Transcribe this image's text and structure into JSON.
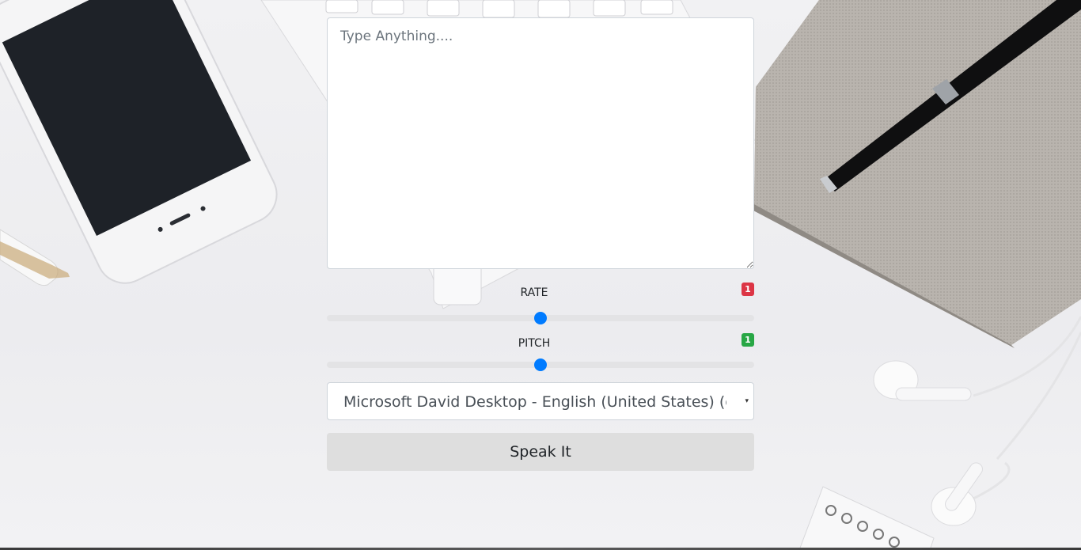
{
  "text_input": {
    "placeholder": "Type Anything....",
    "value": ""
  },
  "rate": {
    "label": "RATE",
    "value": 1,
    "value_text": "1",
    "min": 0.5,
    "max": 1.5,
    "badge_color": "#dc3545"
  },
  "pitch": {
    "label": "PITCH",
    "value": 1,
    "value_text": "1",
    "min": 0,
    "max": 2,
    "badge_color": "#28a745"
  },
  "voice_select": {
    "selected": "Microsoft David Desktop - English (United States) (en-US)"
  },
  "speak_button": {
    "label": "Speak It"
  },
  "colors": {
    "accent": "#007bff",
    "button_bg": "#dedede"
  },
  "icons": {
    "select_caret": "▾"
  }
}
